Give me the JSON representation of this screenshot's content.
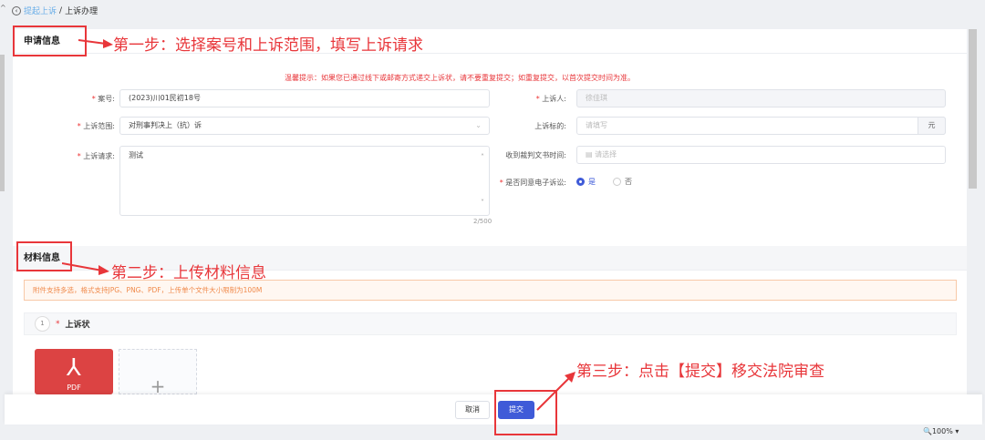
{
  "breadcrumb": {
    "parent": "提起上诉",
    "separator": "/",
    "current": "上诉办理"
  },
  "section1": {
    "title": "申请信息",
    "notice": "温馨提示：如果您已通过线下或邮寄方式递交上诉状，请不要重复提交；如重复提交，以首次提交时间为准。"
  },
  "form": {
    "case_no": {
      "label": "案号:",
      "value": "(2023)川01民初18号"
    },
    "scope": {
      "label": "上诉范围:",
      "value": "对刑事判决上（抗）诉"
    },
    "request": {
      "label": "上诉请求:",
      "value": "测试",
      "counter": "2/500"
    },
    "appellant": {
      "label": "上诉人:",
      "value": "徐佳琪"
    },
    "amount": {
      "label": "上诉标的:",
      "placeholder": "请填写",
      "unit": "元"
    },
    "receive_time": {
      "label": "收到裁判文书时间:",
      "placeholder": "请选择"
    },
    "e_litigation": {
      "label": "是否同意电子诉讼:",
      "yes": "是",
      "no": "否",
      "selected": "是"
    }
  },
  "section2": {
    "title": "材料信息",
    "notice": "附件支持多选，格式支持JPG、PNG、PDF，上传单个文件大小限制为100M"
  },
  "material": {
    "index": "1",
    "title": "上诉状",
    "file_type": "PDF"
  },
  "footer": {
    "cancel": "取消",
    "submit": "提交"
  },
  "status": {
    "zoom": "100%"
  },
  "annotations": {
    "step1": "第一步：选择案号和上诉范围，填写上诉请求",
    "step2": "第二步：上传材料信息",
    "step3": "第三步：点击【提交】移交法院审查"
  },
  "colors": {
    "accent": "#3f5bd8",
    "annotation": "#e8363a"
  }
}
